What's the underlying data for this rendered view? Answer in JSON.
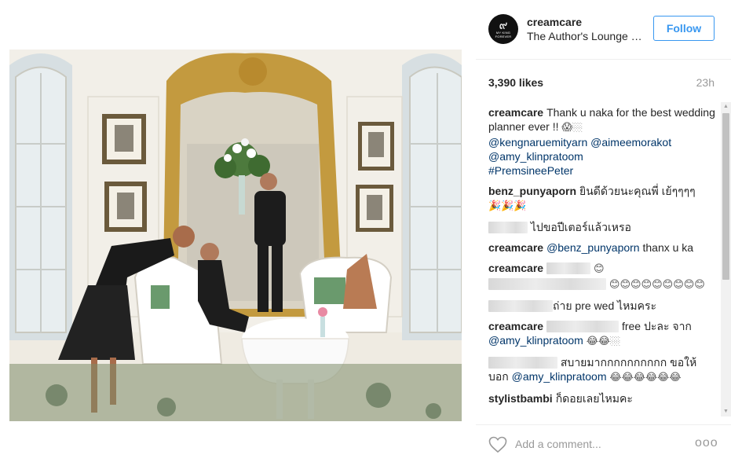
{
  "post": {
    "photo_alt": "Photo",
    "header": {
      "username": "creamcare",
      "location": "The Author's Lounge - Mandarin Oriental",
      "follow_label": "Follow",
      "avatar_glyph": "๙",
      "avatar_caption": "MY KING FOREVER"
    },
    "likes": "3,390 likes",
    "time_ago": "23h",
    "comments": [
      {
        "user": "creamcare",
        "text": "Thank u naka for the best wedding planner ever !! ",
        "emoji": "😱🏼",
        "mentions": [
          "@kengnaruemityarn",
          "@aimeemorakot",
          "@amy_klinpratoom"
        ],
        "hashtag": "#PremsineePeter"
      },
      {
        "user": "benz_punyaporn",
        "text": "ยินดีด้วยนะคุณพี่ เย้ๆๆๆๆ",
        "emoji": "🎉🎉🎉"
      },
      {
        "user": "",
        "text": "ไปขอปีเตอร์แล้วเหรอ"
      },
      {
        "user": "creamcare",
        "mention": "@benz_punyaporn",
        "text": " thanx u ka"
      },
      {
        "user": "creamcare",
        "emoji": "😊"
      },
      {
        "user": "",
        "emoji": "😊😊😊😊😊😊😊😊😊"
      },
      {
        "user": "",
        "text": "ถ่าย pre wed ไหมคระ"
      },
      {
        "user": "creamcare",
        "text": "free ปะละ จาก",
        "mention": "@amy_klinpratoom",
        "emoji": "😂😂🏼"
      },
      {
        "user": "",
        "text": "สบายมากกกกกกกกกก ขอให้บอก",
        "mention": "@amy_klinpratoom",
        "emoji": "😂😂😂😂😂😂"
      },
      {
        "user": "stylistbambi",
        "text": "ก็ดอยเลยไหมคะ"
      }
    ],
    "add_comment_placeholder": "Add a comment...",
    "more_label": "ooo"
  },
  "colors": {
    "accent": "#3897f0",
    "link": "#003569",
    "muted": "#999999",
    "border": "#efefef"
  },
  "icons": {
    "like": "heart-icon",
    "options": "more-options-icon"
  }
}
